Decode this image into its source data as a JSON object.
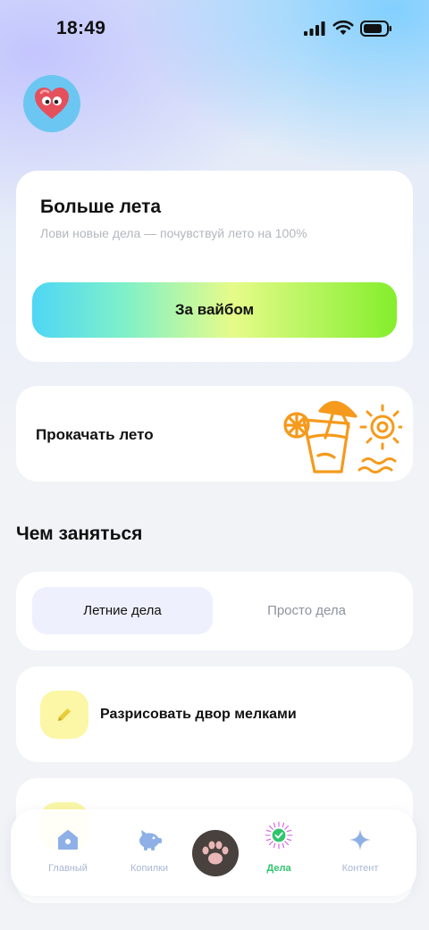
{
  "status_bar": {
    "time": "18:49",
    "icons": [
      "signal-icon",
      "wifi-icon",
      "battery-icon"
    ]
  },
  "profile": {
    "avatar_icon": "heart-avatar-icon"
  },
  "promo": {
    "title": "Больше лета",
    "subtitle": "Лови новые дела — почувствуй лето на 100%",
    "button_label": "За вайбом"
  },
  "boost": {
    "title": "Прокачать лето",
    "art_icons": [
      "summer-drink-icon",
      "sun-icon",
      "waves-icon"
    ]
  },
  "section": {
    "title": "Чем заняться"
  },
  "tabs": [
    {
      "label": "Летние дела",
      "active": true
    },
    {
      "label": "Просто дела",
      "active": false
    }
  ],
  "tasks": [
    {
      "label": "Разрисовать двор мелками",
      "icon": "pencil-icon"
    }
  ],
  "tabbar": {
    "items": [
      {
        "label": "Главный",
        "icon": "home-icon"
      },
      {
        "label": "Копилки",
        "icon": "piggy-bank-icon"
      },
      {
        "label": "",
        "icon": "paw-icon"
      },
      {
        "label": "Дела",
        "icon": "check-badge-icon",
        "active": true
      },
      {
        "label": "Контент",
        "icon": "sparkle-icon"
      }
    ]
  },
  "colors": {
    "accent_green": "#2fc56b",
    "button_gradient": [
      "#4fd6f5",
      "#e6fb89",
      "#84ee2c"
    ],
    "art_orange": "#f59a1c",
    "tab_active_bg": "#eef0fd",
    "task_icon_bg": "#fbf7a6"
  }
}
